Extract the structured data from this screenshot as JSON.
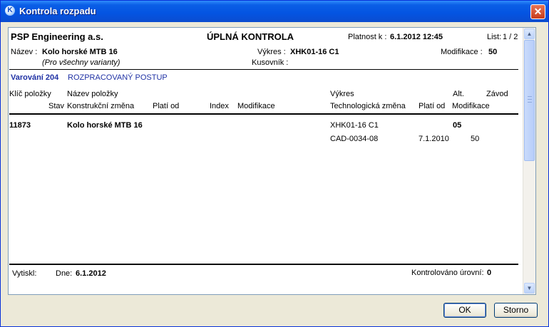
{
  "window": {
    "title": "Kontrola rozpadu",
    "icon": "K"
  },
  "report": {
    "company": "PSP Engineering a.s.",
    "heading": "ÚPLNÁ KONTROLA",
    "validity_label": "Platnost k :",
    "validity_value": "6.1.2012  12:45",
    "sheet_label": "List:",
    "sheet_value": "1 / 2",
    "name_label": "Název :",
    "name_value": "Kolo horské MTB 16",
    "variants_note": "(Pro všechny varianty)",
    "drawing_label": "Výkres :",
    "drawing_value": "XHK01-16 C1",
    "modification_label": "Modifikace :",
    "modification_value": "50",
    "bom_label": "Kusovník :",
    "warning_code": "Varování 204",
    "warning_text": "ROZPRACOVANÝ POSTUP",
    "columns": {
      "item_key": "Klíč položky",
      "item_name": "Název položky",
      "drawing": "Výkres",
      "alt": "Alt.",
      "plant": "Závod",
      "status": "Stav",
      "construction_change": "Konstrukční změna",
      "valid_from": "Platí od",
      "index": "Index",
      "modification": "Modifikace",
      "technology_change": "Technologická změna",
      "valid_from_2": "Platí od",
      "modification_2": "Modifikace"
    },
    "row": {
      "item_key": "11873",
      "item_name": "Kolo horské MTB 16",
      "drawing": "XHK01-16 C1",
      "alt": "05",
      "technology_change": "CAD-0034-08",
      "valid_from": "7.1.2010",
      "modification": "50"
    },
    "footer": {
      "printed_label": "Vytiskl:",
      "date_label": "Dne:",
      "date_value": "6.1.2012",
      "checked_label": "Kontrolováno úrovní:",
      "checked_value": "0"
    }
  },
  "buttons": {
    "ok": "OK",
    "cancel": "Storno"
  },
  "icons": {
    "scroll_up": "▲",
    "scroll_down": "▼",
    "close": "✕"
  }
}
